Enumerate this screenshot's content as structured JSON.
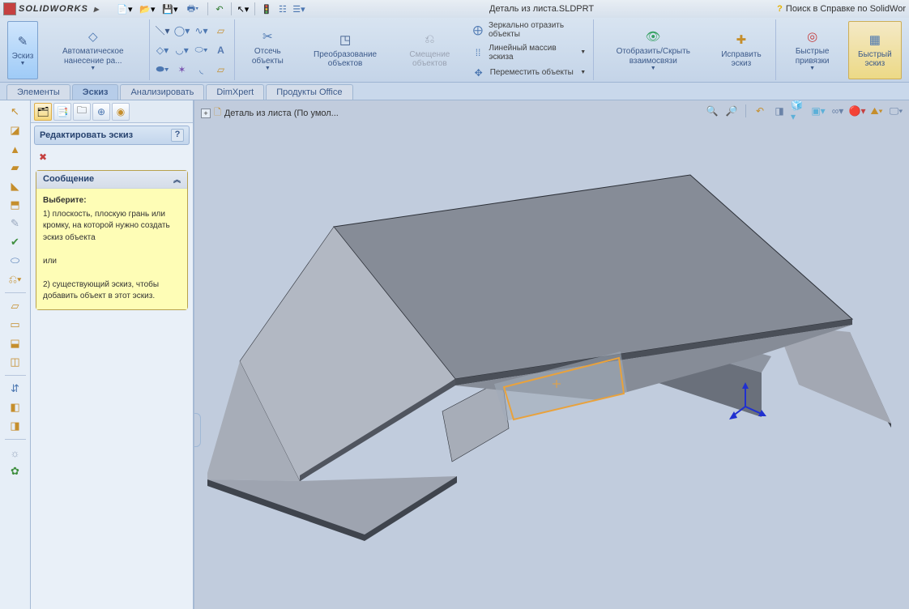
{
  "app": {
    "name": "SOLIDWORKS",
    "doc_title": "Деталь из листа.SLDPRT",
    "search_label": "Поиск в Справке по SolidWor"
  },
  "ribbon": {
    "sketch_btn": "Эскиз",
    "smart_dim": "Автоматическое нанесение ра...",
    "trim": "Отсечь объекты",
    "convert": "Преобразование объектов",
    "offset": "Смещение объектов",
    "mirror": "Зеркально отразить объекты",
    "linear_pattern": "Линейный массив эскиза",
    "move": "Переместить объекты",
    "display_relations": "Отобразить/Скрыть взаимосвязи",
    "repair": "Исправить эскиз",
    "quick_snaps": "Быстрые привязки",
    "rapid_sketch": "Быстрый эскиз"
  },
  "tabs": {
    "features": "Элементы",
    "sketch": "Эскиз",
    "evaluate": "Анализировать",
    "dimxpert": "DimXpert",
    "office": "Продукты Office"
  },
  "panel": {
    "header": "Редактировать эскиз",
    "msg_title": "Сообщение",
    "msg_intro": "Выберите:",
    "msg_opt1": "1) плоскость, плоскую грань или кромку, на которой нужно создать эскиз объекта",
    "msg_or": "или",
    "msg_opt2": "2) существующий эскиз, чтобы добавить объект в этот эскиз."
  },
  "flyout": {
    "text": "Деталь из листа  (По умол..."
  },
  "colors": {
    "steel_top": "#7D838D",
    "steel_side": "#969CA8",
    "steel_dark": "#5A606A",
    "steel_light": "#B7BDC7",
    "highlight": "#E9A23C"
  }
}
